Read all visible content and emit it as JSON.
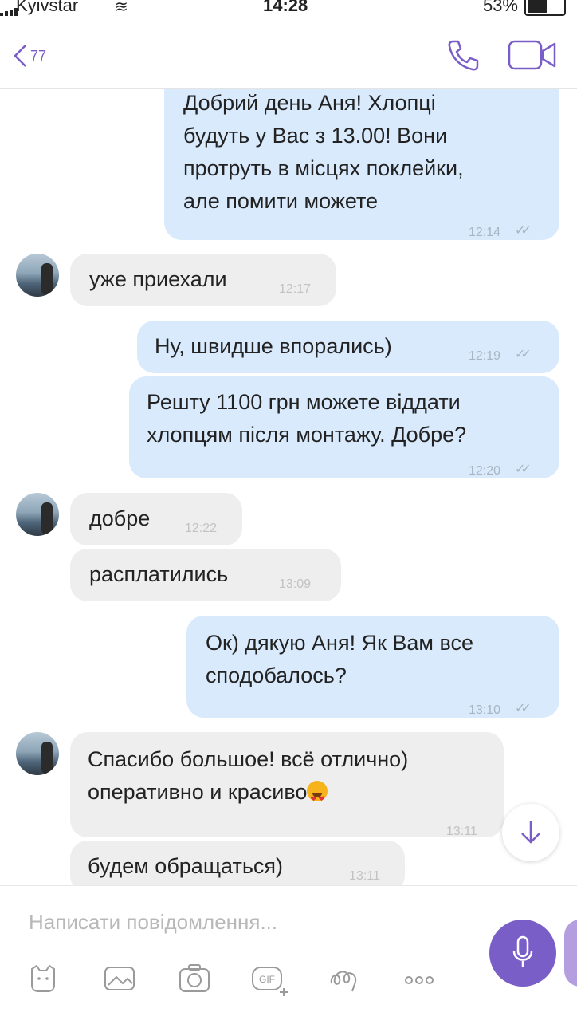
{
  "status": {
    "carrier": "Kyivstar",
    "time": "14:28",
    "battery": "53%"
  },
  "header": {
    "back_count": "77"
  },
  "messages": [
    {
      "dir": "out",
      "text": [
        "Добрий день Аня! Хлопці",
        "будуть у Вас з 13.00! Вони",
        "протруть в місцях поклейки,",
        "але помити можете"
      ],
      "time": "12:14"
    },
    {
      "dir": "in",
      "text": [
        "уже приехали"
      ],
      "time": "12:17"
    },
    {
      "dir": "out",
      "text": [
        "Ну, швидше впорались)"
      ],
      "time": "12:19"
    },
    {
      "dir": "out",
      "text": [
        "Решту 1100 грн можете віддати",
        "хлопцям після монтажу. Добре?"
      ],
      "time": "12:20"
    },
    {
      "dir": "in",
      "text": [
        "добре"
      ],
      "time": "12:22"
    },
    {
      "dir": "in",
      "text": [
        "расплатились"
      ],
      "time": "13:09"
    },
    {
      "dir": "out",
      "text": [
        "Ок) дякую Аня! Як Вам все",
        "сподобалось?"
      ],
      "time": "13:10"
    },
    {
      "dir": "in",
      "text": [
        "Спасибо большое! всё отлично)",
        "оперативно и красиво"
      ],
      "time": "13:11"
    },
    {
      "dir": "in",
      "text": [
        "будем обращаться)"
      ],
      "time": "13:11"
    }
  ],
  "composer": {
    "placeholder": "Написати повідомлення..."
  },
  "icons": {
    "back": "chevron-left-icon",
    "call": "phone-icon",
    "video": "video-camera-icon",
    "scroll": "arrow-down-icon",
    "mic": "microphone-icon",
    "toolbar": [
      "sticker-icon",
      "gallery-icon",
      "camera-icon",
      "gif-icon",
      "doodle-icon",
      "more-icon"
    ]
  },
  "colors": {
    "accent": "#7a5ec8",
    "outgoing_bubble": "#d9eafc",
    "incoming_bubble": "#eeeeee"
  }
}
